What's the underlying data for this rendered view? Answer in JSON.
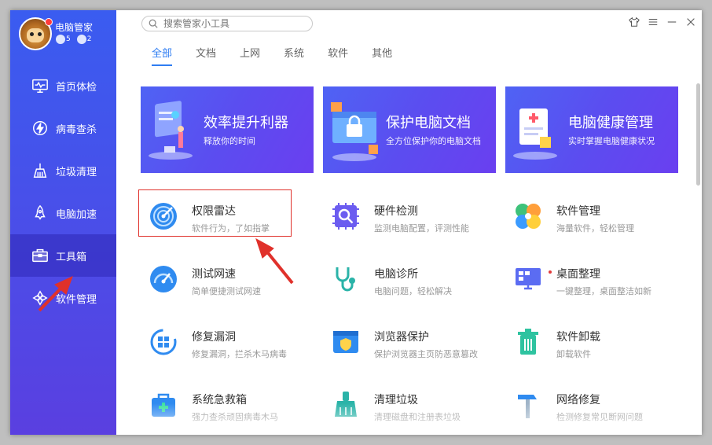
{
  "app": {
    "title": "电脑管家",
    "badge1": "5",
    "badge2": "2"
  },
  "sidebar": {
    "items": [
      {
        "label": "首页体检",
        "icon": "monitor-pulse-icon",
        "active": false
      },
      {
        "label": "病毒查杀",
        "icon": "lightning-shield-icon",
        "active": false
      },
      {
        "label": "垃圾清理",
        "icon": "broom-icon",
        "active": false
      },
      {
        "label": "电脑加速",
        "icon": "rocket-icon",
        "active": false
      },
      {
        "label": "工具箱",
        "icon": "toolbox-icon",
        "active": true
      },
      {
        "label": "软件管理",
        "icon": "software-icon",
        "active": false
      }
    ]
  },
  "search": {
    "placeholder": "搜索管家小工具"
  },
  "tabs": [
    {
      "label": "全部",
      "active": true
    },
    {
      "label": "文档",
      "active": false
    },
    {
      "label": "上网",
      "active": false
    },
    {
      "label": "系统",
      "active": false
    },
    {
      "label": "软件",
      "active": false
    },
    {
      "label": "其他",
      "active": false
    }
  ],
  "banners": [
    {
      "title": "效率提升利器",
      "subtitle": "释放你的时间"
    },
    {
      "title": "保护电脑文档",
      "subtitle": "全方位保护你的电脑文档"
    },
    {
      "title": "电脑健康管理",
      "subtitle": "实时掌握电脑健康状况"
    }
  ],
  "tools": [
    {
      "name": "权限雷达",
      "desc": "软件行为，了如指掌",
      "icon": "radar-icon"
    },
    {
      "name": "硬件检测",
      "desc": "监测电脑配置，评测性能",
      "icon": "chip-search-icon"
    },
    {
      "name": "软件管理",
      "desc": "海量软件，轻松管理",
      "icon": "clover-icon"
    },
    {
      "name": "测试网速",
      "desc": "简单便捷测试网速",
      "icon": "speedometer-icon"
    },
    {
      "name": "电脑诊所",
      "desc": "电脑问题，轻松解决",
      "icon": "stethoscope-icon"
    },
    {
      "name": "桌面整理",
      "desc": "一键整理，桌面整洁如新",
      "icon": "desktop-organize-icon"
    },
    {
      "name": "修复漏洞",
      "desc": "修复漏洞，拦杀木马病毒",
      "icon": "windows-repair-icon"
    },
    {
      "name": "浏览器保护",
      "desc": "保护浏览器主页防恶意篡改",
      "icon": "browser-shield-icon"
    },
    {
      "name": "软件卸载",
      "desc": "卸载软件",
      "icon": "trash-icon"
    },
    {
      "name": "系统急救箱",
      "desc": "强力查杀顽固病毒木马",
      "icon": "first-aid-icon"
    },
    {
      "name": "清理垃圾",
      "desc": "清理磁盘和注册表垃圾",
      "icon": "brush-icon"
    },
    {
      "name": "网络修复",
      "desc": "检测修复常见断网问题",
      "icon": "hammer-icon"
    }
  ],
  "colors": {
    "accent": "#2f7df2",
    "sidebar": "#4a50ea",
    "highlight": "#e0312b"
  }
}
